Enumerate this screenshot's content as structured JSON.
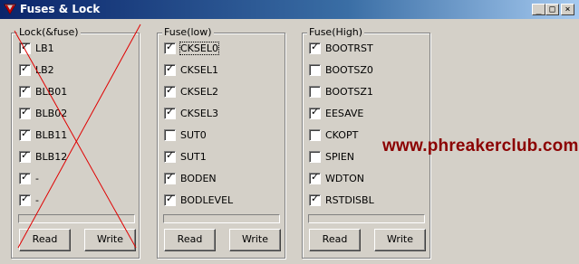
{
  "window": {
    "title": "Fuses & Lock"
  },
  "caption_buttons": {
    "minimize": "_",
    "maximize": "□",
    "close": "×"
  },
  "groups": [
    {
      "label": "Lock(&fuse)",
      "items": [
        {
          "label": "LB1",
          "checked": true
        },
        {
          "label": "LB2",
          "checked": true
        },
        {
          "label": "BLB01",
          "checked": true
        },
        {
          "label": "BLB02",
          "checked": true
        },
        {
          "label": "BLB11",
          "checked": true
        },
        {
          "label": "BLB12",
          "checked": true
        },
        {
          "label": "-",
          "checked": true
        },
        {
          "label": "-",
          "checked": true
        }
      ],
      "read_label": "Read",
      "write_label": "Write",
      "progress": 0
    },
    {
      "label": "Fuse(low)",
      "items": [
        {
          "label": "CKSEL0",
          "checked": true
        },
        {
          "label": "CKSEL1",
          "checked": true
        },
        {
          "label": "CKSEL2",
          "checked": true
        },
        {
          "label": "CKSEL3",
          "checked": true
        },
        {
          "label": "SUT0",
          "checked": false
        },
        {
          "label": "SUT1",
          "checked": true
        },
        {
          "label": "BODEN",
          "checked": true
        },
        {
          "label": "BODLEVEL",
          "checked": true
        }
      ],
      "read_label": "Read",
      "write_label": "Write",
      "progress": 0
    },
    {
      "label": "Fuse(High)",
      "items": [
        {
          "label": "BOOTRST",
          "checked": true
        },
        {
          "label": "BOOTSZ0",
          "checked": false
        },
        {
          "label": "BOOTSZ1",
          "checked": false
        },
        {
          "label": "EESAVE",
          "checked": true
        },
        {
          "label": "CKOPT",
          "checked": false
        },
        {
          "label": "SPIEN",
          "checked": false
        },
        {
          "label": "WDTON",
          "checked": true
        },
        {
          "label": "RSTDISBL",
          "checked": true
        }
      ],
      "read_label": "Read",
      "write_label": "Write",
      "progress": 0
    }
  ],
  "watermark": "www.phreakerclub.com",
  "colors": {
    "titlebar": "#0a246a",
    "watermark": "#8b0000",
    "cross": "#e00000"
  }
}
